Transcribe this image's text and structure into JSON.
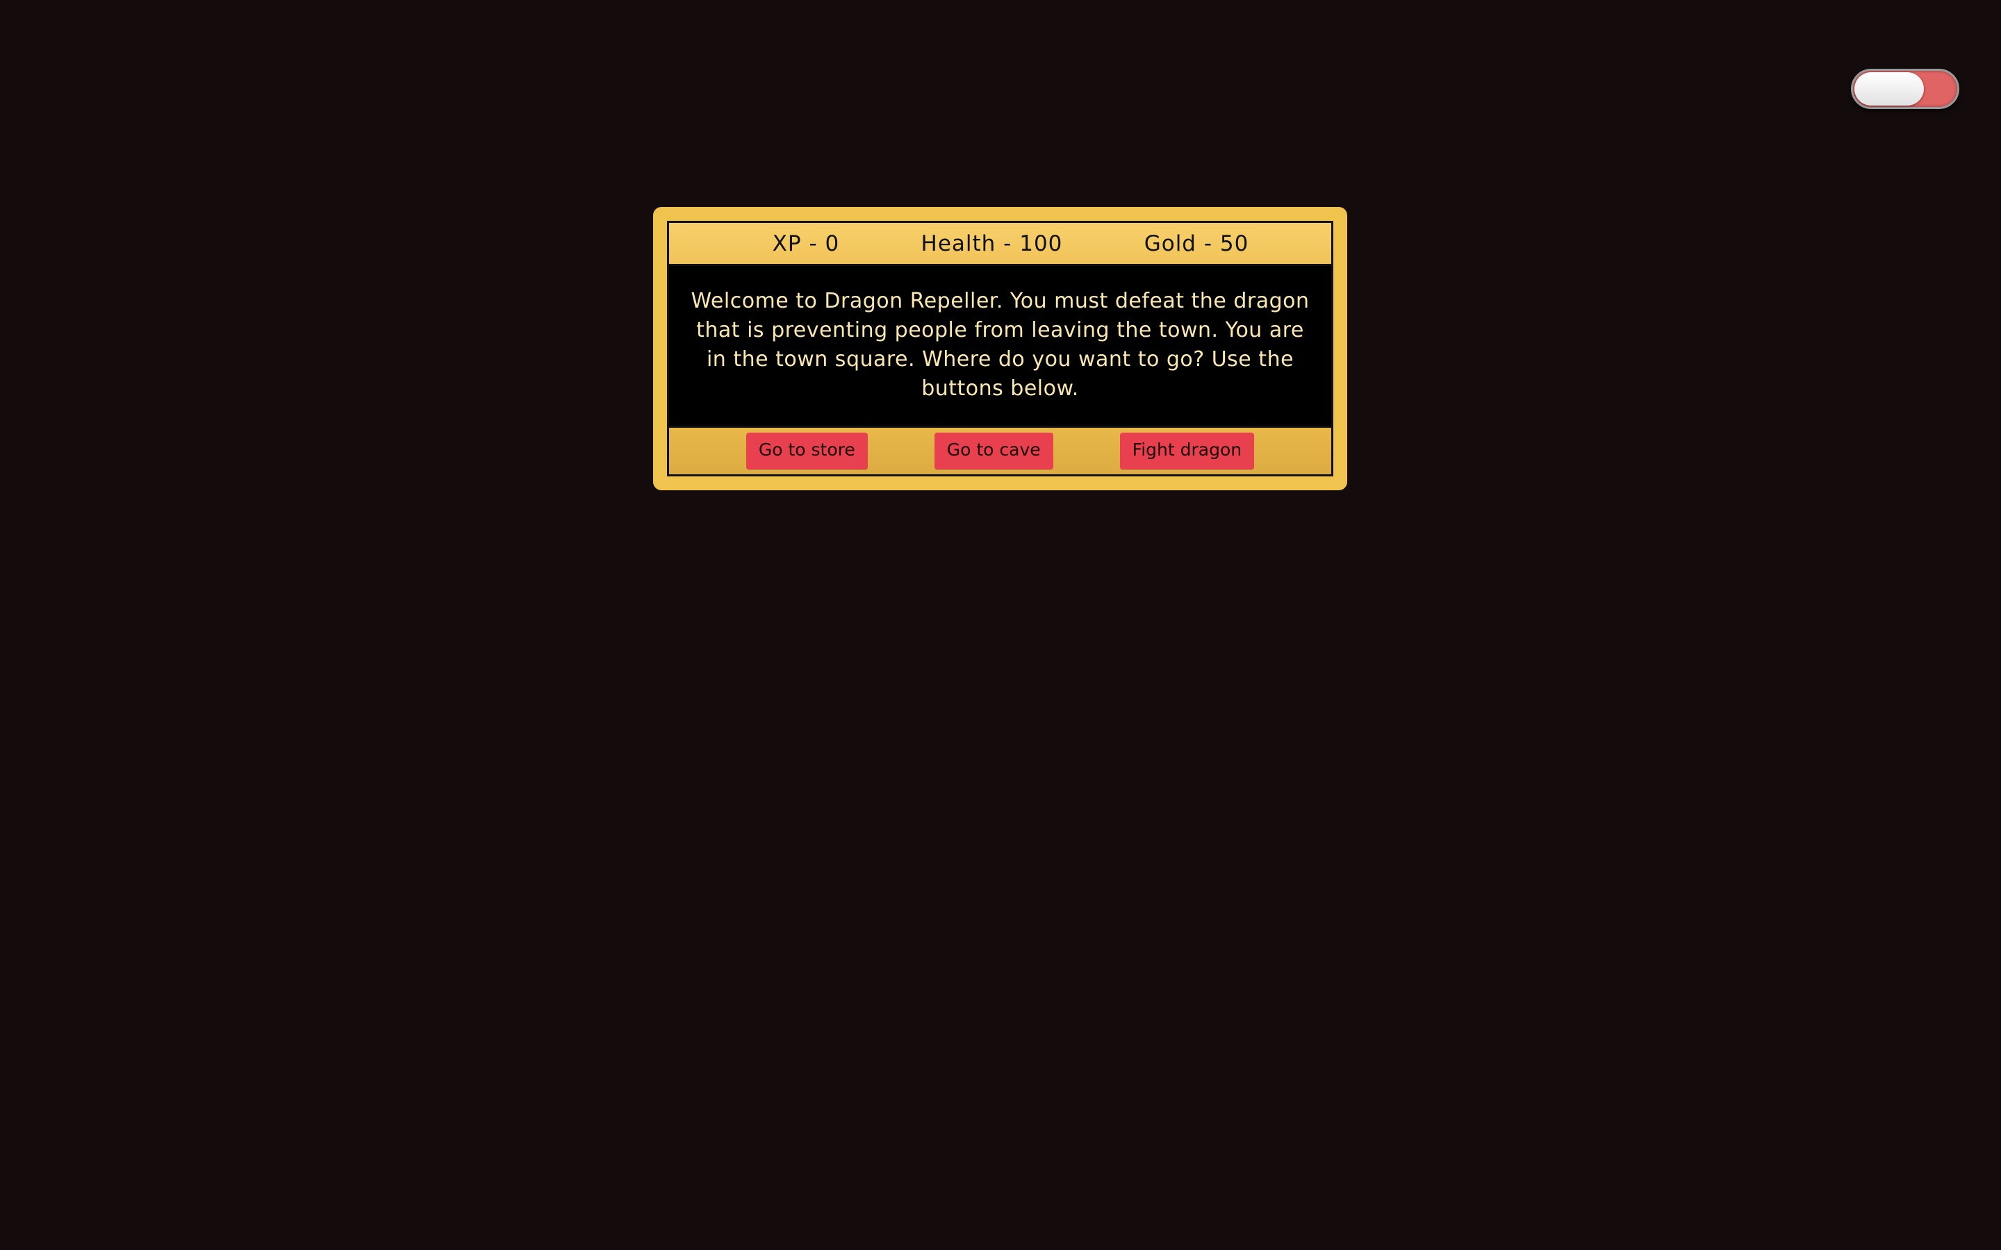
{
  "stats": {
    "xp": "XP - 0",
    "health": "Health - 100",
    "gold": "Gold - 50"
  },
  "text": "Welcome to Dragon Repeller. You must defeat the dragon that is preventing people from leaving the town. You are in the town square. Where do you want to go? Use the buttons below.",
  "controls": {
    "button1": "Go to store",
    "button2": "Go to cave",
    "button3": "Fight dragon"
  },
  "theme_toggle": {
    "state": "on",
    "track_color": "#e06464",
    "knob_color": "#ffffff"
  },
  "colors": {
    "background": "#140c0c",
    "frame": "#f0c24e",
    "button": "#e8404e",
    "text": "#fbe7b0"
  }
}
